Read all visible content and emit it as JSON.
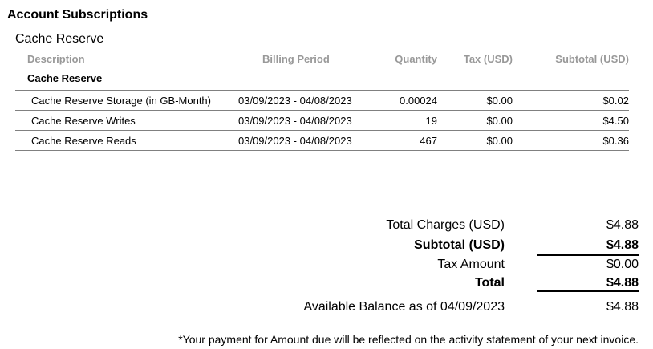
{
  "section_title": "Account Subscriptions",
  "product_title": "Cache Reserve",
  "table": {
    "headers": {
      "description": "Description",
      "billing_period": "Billing Period",
      "quantity": "Quantity",
      "tax": "Tax (USD)",
      "subtotal": "Subtotal (USD)"
    },
    "group_label": "Cache Reserve",
    "rows": [
      {
        "description": "Cache Reserve Storage (in GB-Month)",
        "billing_period": "03/09/2023 - 04/08/2023",
        "quantity": "0.00024",
        "tax": "$0.00",
        "subtotal": "$0.02"
      },
      {
        "description": "Cache Reserve Writes",
        "billing_period": "03/09/2023 - 04/08/2023",
        "quantity": "19",
        "tax": "$0.00",
        "subtotal": "$4.50"
      },
      {
        "description": "Cache Reserve Reads",
        "billing_period": "03/09/2023 - 04/08/2023",
        "quantity": "467",
        "tax": "$0.00",
        "subtotal": "$0.36"
      }
    ]
  },
  "totals": {
    "total_charges_label": "Total Charges (USD)",
    "total_charges_value": "$4.88",
    "subtotal_label": "Subtotal (USD)",
    "subtotal_value": "$4.88",
    "tax_amount_label": "Tax Amount",
    "tax_amount_value": "$0.00",
    "total_label": "Total",
    "total_value": "$4.88",
    "available_balance_label": "Available Balance as of 04/09/2023",
    "available_balance_value": "$4.88"
  },
  "footnote": "*Your payment for Amount due will be reflected on the activity statement of your next invoice."
}
